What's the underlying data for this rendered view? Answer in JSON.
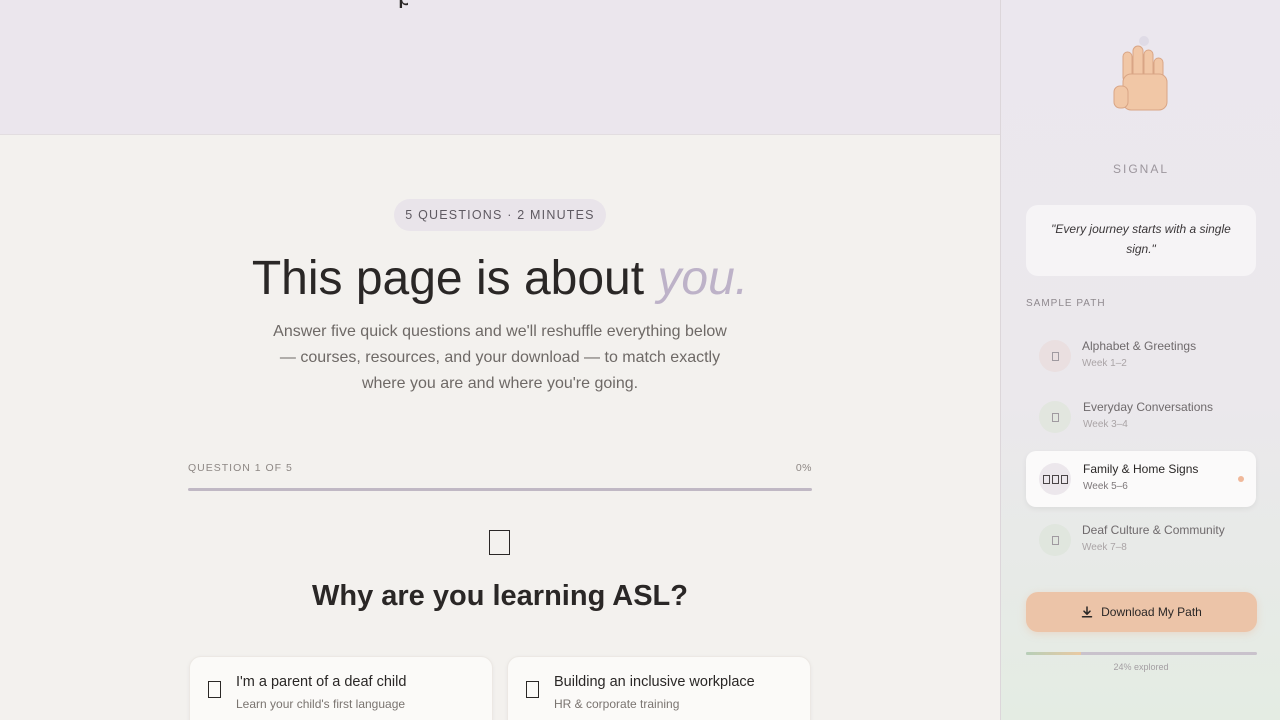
{
  "main": {
    "pill": "5 QUESTIONS · 2 MINUTES",
    "headline": "This page is about",
    "headline_accent": "you.",
    "subtext": "Answer five quick questions and we'll reshuffle everything below — courses, resources, and your download — to match exactly where you are and where you're going.",
    "question_counter": "QUESTION 1 OF 5",
    "progress_label": "0%",
    "progress": 0,
    "question": "Why are you learning ASL?",
    "options": [
      {
        "title": "I'm a parent of a deaf child",
        "subtitle": "Learn your child's first language"
      },
      {
        "title": "Building an inclusive workplace",
        "subtitle": "HR & corporate training"
      }
    ]
  },
  "sidebar": {
    "brand": "SIGNAL",
    "quote": "\"Every journey starts with a single sign.\"",
    "sample_label": "SAMPLE PATH",
    "path": [
      {
        "title": "Alphabet & Greetings",
        "week": "Week 1–2",
        "icon_color": "#eadfe0",
        "active": false
      },
      {
        "title": "Everyday Conversations",
        "week": "Week 3–4",
        "icon_color": "#e2e6df",
        "active": false
      },
      {
        "title": "Family & Home Signs",
        "week": "Week 5–6",
        "icon_color": "#ece7ec",
        "active": true
      },
      {
        "title": "Deaf Culture & Community",
        "week": "Week 7–8",
        "icon_color": "#e0e6de",
        "active": false
      }
    ],
    "download_label": "Download My Path",
    "explored_label": "24% explored",
    "explored": 0.24
  },
  "colors": {
    "accent_lavender": "#bdb2c8",
    "download_peach": "#ecc4a8",
    "active_dot": "#f0b89a"
  },
  "icons": [
    "raised-hand-icon",
    "download-icon",
    "question-glyph-icon",
    "option-glyph-icon",
    "path-step-icon"
  ]
}
